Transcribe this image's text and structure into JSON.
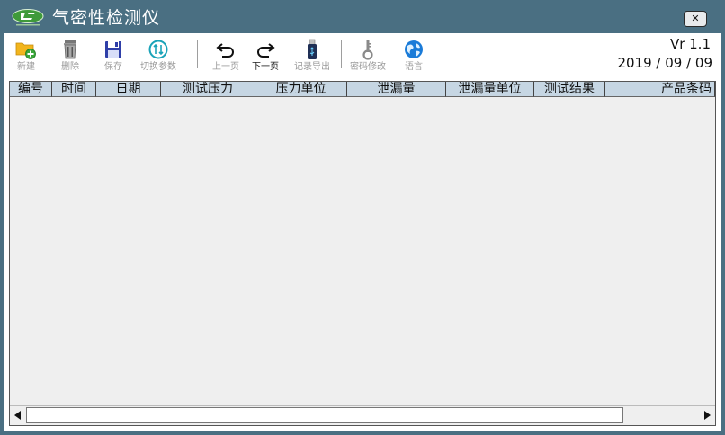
{
  "window": {
    "title": "气密性检测仪",
    "close_label": "×"
  },
  "toolbar": {
    "items": [
      {
        "label": "新建",
        "icon": "folder-add-icon",
        "enabled": false
      },
      {
        "label": "删除",
        "icon": "trash-icon",
        "enabled": false
      },
      {
        "label": "保存",
        "icon": "floppy-disk-icon",
        "enabled": false
      },
      {
        "label": "切换参数",
        "icon": "switch-arrows-icon",
        "enabled": false
      },
      {
        "label": "上一页",
        "icon": "undo-arrow-icon",
        "enabled": false
      },
      {
        "label": "下一页",
        "icon": "redo-arrow-icon",
        "enabled": true
      },
      {
        "label": "记录导出",
        "icon": "usb-drive-icon",
        "enabled": false
      },
      {
        "label": "密码修改",
        "icon": "key-icon",
        "enabled": false
      },
      {
        "label": "语言",
        "icon": "globe-icon",
        "enabled": false
      }
    ],
    "version": "Vr 1.1",
    "date": "2019 / 09 / 09"
  },
  "table": {
    "columns": [
      "编号",
      "时间",
      "日期",
      "测试压力",
      "压力单位",
      "泄漏量",
      "泄漏量单位",
      "测试结果",
      "产品条码"
    ],
    "rows": []
  },
  "colors": {
    "title_bar": "#4a6f82",
    "header_bg": "#c6d6e3",
    "grid_bg": "#efefef"
  }
}
